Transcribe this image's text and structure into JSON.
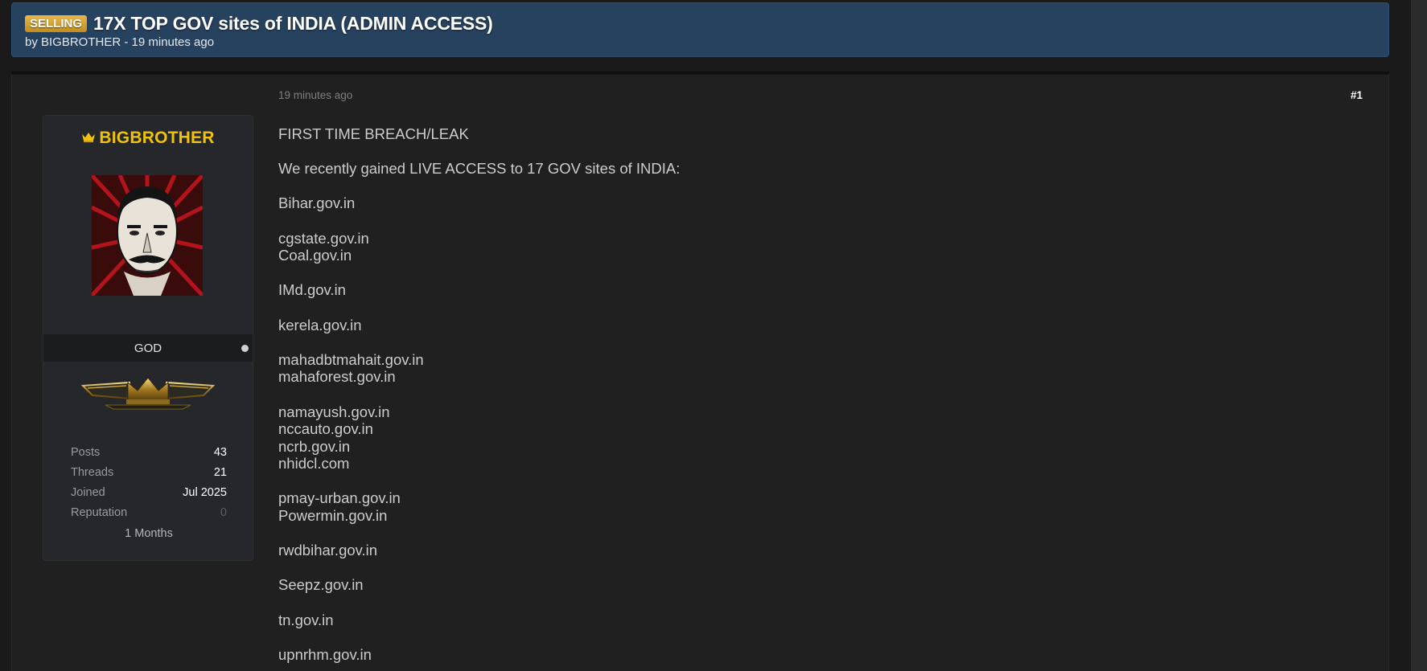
{
  "thread": {
    "prefix": "SELLING",
    "title": "17X TOP GOV sites of INDIA (ADMIN ACCESS)",
    "byline": "by BIGBROTHER - 19 minutes ago"
  },
  "post": {
    "date": "19 minutes ago",
    "number": "#1",
    "paragraphs": [
      [
        "FIRST TIME BREACH/LEAK"
      ],
      [
        "We recently gained LIVE ACCESS to 17 GOV sites of INDIA:"
      ],
      [
        "Bihar.gov.in"
      ],
      [
        "cgstate.gov.in",
        "Coal.gov.in"
      ],
      [
        "IMd.gov.in"
      ],
      [
        "kerela.gov.in"
      ],
      [
        "mahadbtmahait.gov.in",
        "mahaforest.gov.in"
      ],
      [
        "namayush.gov.in",
        "nccauto.gov.in",
        "ncrb.gov.in",
        "nhidcl.com"
      ],
      [
        "pmay-urban.gov.in",
        "Powermin.gov.in"
      ],
      [
        "rwdbihar.gov.in"
      ],
      [
        "Seepz.gov.in"
      ],
      [
        "tn.gov.in"
      ],
      [
        "upnrhm.gov.in"
      ]
    ]
  },
  "author": {
    "username": "BIGBROTHER",
    "rank": "GOD",
    "stats": [
      {
        "label": "Posts",
        "value": "43",
        "muted": false
      },
      {
        "label": "Threads",
        "value": "21",
        "muted": false
      },
      {
        "label": "Joined",
        "value": "Jul 2025",
        "muted": false
      },
      {
        "label": "Reputation",
        "value": "0",
        "muted": true
      }
    ],
    "tenure": "1 Months",
    "icons": {
      "username": "crown-icon",
      "status": "online-status-icon",
      "rank": "crown-wings-emblem-icon"
    }
  },
  "colors": {
    "header_bg": "#27425f",
    "prefix_badge": "#d9a637",
    "username": "#f1c20b",
    "post_bg": "#202020",
    "card_bg": "#25272a"
  }
}
